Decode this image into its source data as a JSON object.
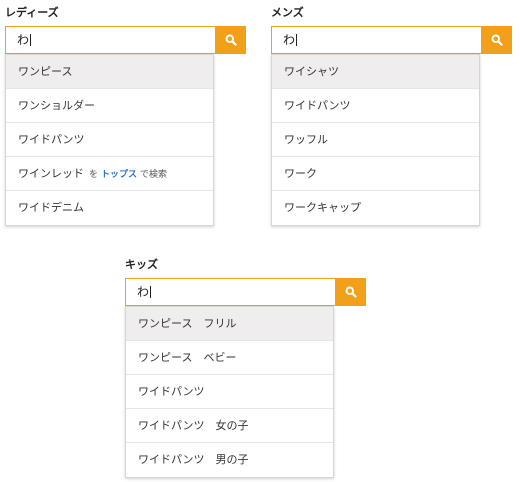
{
  "accent_color": "#f29f1a",
  "ladies": {
    "title": "レディーズ",
    "query": "わ",
    "search_icon": "search-icon",
    "suggestions": [
      {
        "label": "ワンピース"
      },
      {
        "label": "ワンショルダー"
      },
      {
        "label": "ワイドパンツ"
      },
      {
        "label": "ワインレッド",
        "in_text": "を",
        "category": "トップス",
        "suffix": "で検索"
      },
      {
        "label": "ワイドデニム"
      }
    ]
  },
  "mens": {
    "title": "メンズ",
    "query": "わ",
    "search_icon": "search-icon",
    "suggestions": [
      {
        "label": "ワイシャツ"
      },
      {
        "label": "ワイドパンツ"
      },
      {
        "label": "ワッフル"
      },
      {
        "label": "ワーク"
      },
      {
        "label": "ワークキャップ"
      }
    ]
  },
  "kids": {
    "title": "キッズ",
    "query": "わ",
    "search_icon": "search-icon",
    "suggestions": [
      {
        "label": "ワンピース　フリル"
      },
      {
        "label": "ワンピース　ベビー"
      },
      {
        "label": "ワイドパンツ"
      },
      {
        "label": "ワイドパンツ　女の子"
      },
      {
        "label": "ワイドパンツ　男の子"
      }
    ]
  }
}
